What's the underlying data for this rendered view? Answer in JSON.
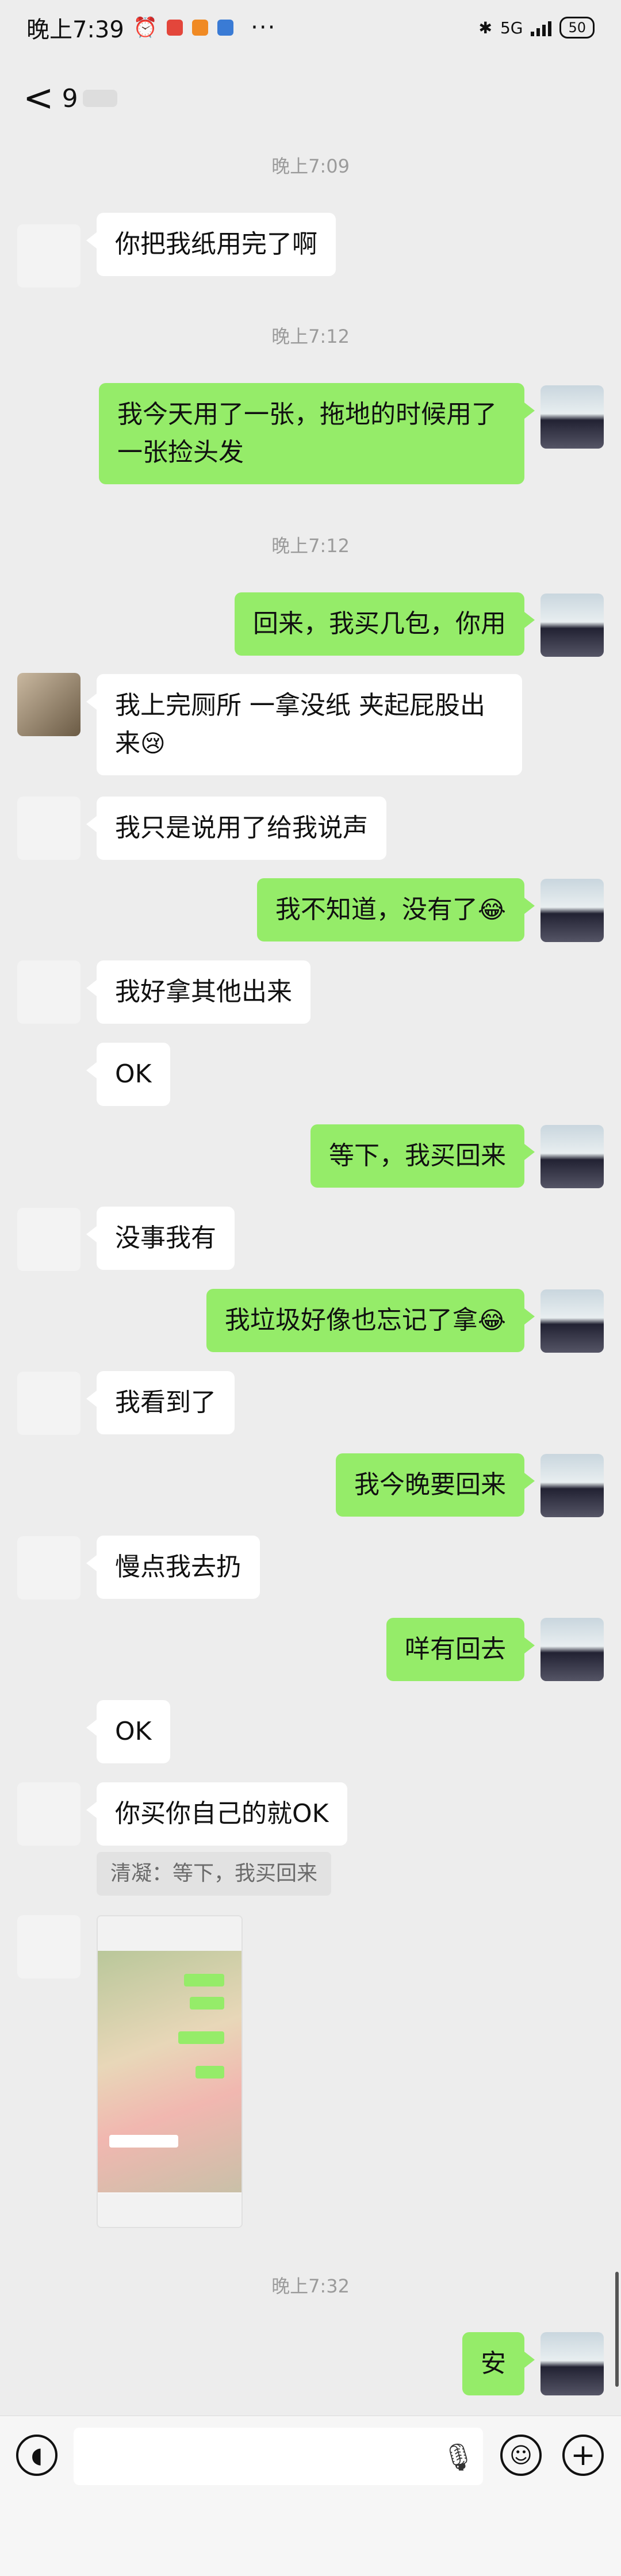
{
  "status_bar": {
    "time": "晚上7:39",
    "more": "···",
    "network": "5G",
    "battery": "50"
  },
  "nav": {
    "back": "<",
    "unread_count": "9"
  },
  "messages": [
    {
      "kind": "time",
      "text": "晚上7:09"
    },
    {
      "kind": "left",
      "text": "你把我纸用完了啊"
    },
    {
      "kind": "time",
      "text": "晚上7:12"
    },
    {
      "kind": "right",
      "text": "我今天用了一张，拖地的时候用了一张捡头发"
    },
    {
      "kind": "time",
      "text": "晚上7:12"
    },
    {
      "kind": "right",
      "text": "回来，我买几包，你用"
    },
    {
      "kind": "left",
      "text": "我上完厕所 一拿没纸 夹起屁股出来",
      "emoji": "😢"
    },
    {
      "kind": "left",
      "text": "我只是说用了给我说声"
    },
    {
      "kind": "right",
      "text": "我不知道，没有了",
      "emoji": "😂"
    },
    {
      "kind": "left",
      "text": "我好拿其他出来"
    },
    {
      "kind": "left",
      "text": "OK"
    },
    {
      "kind": "right",
      "text": "等下，我买回来"
    },
    {
      "kind": "left",
      "text": "没事我有"
    },
    {
      "kind": "right",
      "text": "我垃圾好像也忘记了拿",
      "emoji": "😂"
    },
    {
      "kind": "left",
      "text": "我看到了"
    },
    {
      "kind": "right",
      "text": "我今晚要回来"
    },
    {
      "kind": "left",
      "text": "慢点我去扔"
    },
    {
      "kind": "right",
      "text": "咩有回去"
    },
    {
      "kind": "left",
      "text": "OK"
    },
    {
      "kind": "left",
      "text": "你买你自己的就OK"
    },
    {
      "kind": "quote",
      "text": "清凝：等下，我买回来"
    },
    {
      "kind": "time",
      "text": "晚上7:32"
    },
    {
      "kind": "right",
      "text": "安"
    }
  ],
  "input": {
    "placeholder": ""
  }
}
